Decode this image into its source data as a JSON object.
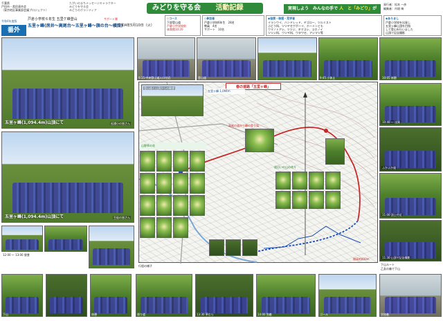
{
  "header": {
    "org_lines": [
      "千葉県",
      "戸田市・県民連合会",
      "（東京地区事業部会議プロジェクト）"
    ],
    "mascot_text": [
      "たがいのまちメッセージキャラクター",
      "みどりを守る会",
      "みどりのボランティア"
    ],
    "title": "みどりを守る会",
    "title_sub": "活動記録",
    "slogan_prefix": "実現しよう　みんなの手で",
    "slogan_mid": "人　と",
    "slogan_highlight": "「みどり」",
    "slogan_suffix": "が輝く千葉県",
    "issuer_lines": [
      "発行者：松本 一彦",
      "編集者：内堀 梅"
    ]
  },
  "event": {
    "edition_label": "令和4年度版",
    "edition": "番外",
    "school": "戸倉小学校６年生 五里ケ峰登山",
    "support": "サポート隊",
    "title": "五里ヶ峰(房井～高尾台～五里ヶ峰～旗の台～横田)",
    "date": "令和4年5月10日（火）"
  },
  "course": {
    "head": "◇コース",
    "lines": [
      "下部登山道",
      "戸倉小中学校前",
      "体育館10:20"
    ]
  },
  "participants": {
    "head": "◇参加者",
    "lines": [
      "戸倉小学校6年生　28名",
      "教員　4名",
      "サポート　10名"
    ]
  },
  "organizations": {
    "head": "◆協賛・後援・見学者",
    "lines": [
      "イランウイ、ハンドレッド、ヤゴロー、ツルミスト",
      "ぶどう科、ツツヤセゲボーイ、ホーミンとも",
      "ウマノトアシ、ツツジ、タマゴシ、コホノイ",
      "ツツジ科、ウツギ科、ウタワセ、アジマツ等"
    ]
  },
  "schedule": {
    "head": "◆あらまし",
    "lines": [
      "戸倉小学校を出発し",
      "五里ヶ峰山頂を目指",
      "して登山を行いました",
      "山頂で記念撮影"
    ]
  },
  "photos": {
    "summit1_caption": "五里ヶ峰(1,094.4m)山頂にて",
    "summit1_label": "松浦小の皆さん",
    "summit2_caption": "五里ヶ峰(1,094.4m)山頂にて",
    "summit2_label": "生徒の皆さん",
    "top_captions": [
      "行程の様子",
      "9:15 中央登山道入口付近",
      "登山道",
      "9:45 小休止",
      "10:05 休憩"
    ],
    "right_captions": [
      "10:40 ～ 出発",
      "ふかふか道",
      "11:00 頂上付近",
      "11:30 山頂で記念撮影",
      "下山ルート",
      "乙女の森で下山"
    ],
    "bottom_captions": [
      "12:00 ～ 13:00 昼食",
      "下山",
      "休憩",
      "帰り道",
      "13:30 草むら",
      "14:00 到着",
      "ゴール",
      "学校着"
    ]
  },
  "map": {
    "title": "春の道路「五里ヶ峰」",
    "peak": "五里ヶ峰 1,094m",
    "note": "高尾の道から峰の登り見",
    "elevation": "標高約800m",
    "small_photo_caption": "登山道と山頂からの眺望",
    "flower_caption": "山野草の花",
    "insect_caption": "道沿いの山の花々"
  },
  "colors": {
    "brand_green": "#2f8a3a",
    "accent_blue": "#1a6fb3",
    "route_red": "#c62828",
    "uniform_blue": "#3b3fa3"
  }
}
